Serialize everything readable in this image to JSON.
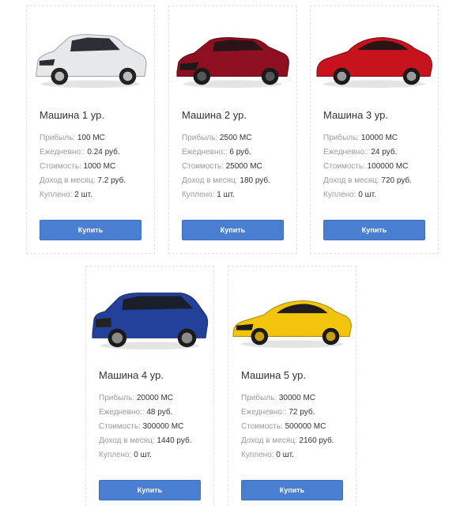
{
  "cards": [
    {
      "title": "Машина 1 ур.",
      "profit_label": "Прибыль:",
      "profit_value": "100 МС",
      "daily_label": "Ежедневно::",
      "daily_value": "0.24 руб.",
      "cost_label": "Стоимость:",
      "cost_value": "1000 МС",
      "monthly_label": "Доход в месяц:",
      "monthly_value": "7.2 руб.",
      "bought_label": "Куплено:",
      "bought_value": "2 шт.",
      "button": "Купить",
      "car_color": "#e6e8ea"
    },
    {
      "title": "Машина 2 ур.",
      "profit_label": "Прибыль:",
      "profit_value": "2500 МС",
      "daily_label": "Ежедневно::",
      "daily_value": "6 руб.",
      "cost_label": "Стоимость:",
      "cost_value": "25000 МС",
      "monthly_label": "Доход в месяц:",
      "monthly_value": "180 руб.",
      "bought_label": "Куплено:",
      "bought_value": "1 шт.",
      "button": "Купить",
      "car_color": "#8e1020"
    },
    {
      "title": "Машина 3 ур.",
      "profit_label": "Прибыль:",
      "profit_value": "10000 МС",
      "daily_label": "Ежедневно::",
      "daily_value": "24 руб.",
      "cost_label": "Стоимость:",
      "cost_value": "100000 МС",
      "monthly_label": "Доход в месяц:",
      "monthly_value": "720 руб.",
      "bought_label": "Куплено:",
      "bought_value": "0 шт.",
      "button": "Купить",
      "car_color": "#c8121e"
    },
    {
      "title": "Машина 4 ур.",
      "profit_label": "Прибыль:",
      "profit_value": "20000 МС",
      "daily_label": "Ежедневно::",
      "daily_value": "48 руб.",
      "cost_label": "Стоимость:",
      "cost_value": "300000 МС",
      "monthly_label": "Доход в месяц:",
      "monthly_value": "1440 руб.",
      "bought_label": "Куплено:",
      "bought_value": "0 шт.",
      "button": "Купить",
      "car_color": "#23409a"
    },
    {
      "title": "Машина 5 ур.",
      "profit_label": "Прибыль:",
      "profit_value": "30000 МС",
      "daily_label": "Ежедневно::",
      "daily_value": "72 руб.",
      "cost_label": "Стоимость:",
      "cost_value": "500000 МС",
      "monthly_label": "Доход в месяц:",
      "monthly_value": "2160 руб.",
      "bought_label": "Куплено:",
      "bought_value": "0 шт.",
      "button": "Купить",
      "car_color": "#f2c40c"
    }
  ]
}
